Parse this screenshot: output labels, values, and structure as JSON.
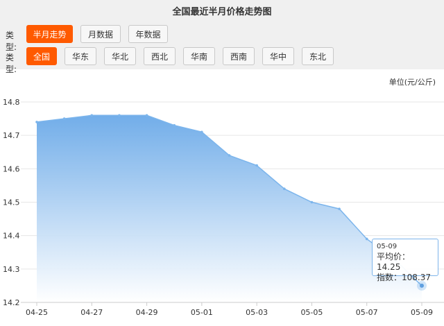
{
  "header": {
    "title": "全国最近半月价格走势图",
    "type_label_1": "类型:",
    "type_label_2": "类型:",
    "period_buttons": [
      {
        "label": "半月走势",
        "active": true
      },
      {
        "label": "月数据",
        "active": false
      },
      {
        "label": "年数据",
        "active": false
      }
    ],
    "region_buttons": [
      {
        "label": "全国",
        "active": true
      },
      {
        "label": "华东",
        "active": false
      },
      {
        "label": "华北",
        "active": false
      },
      {
        "label": "西北",
        "active": false
      },
      {
        "label": "华南",
        "active": false
      },
      {
        "label": "西南",
        "active": false
      },
      {
        "label": "华中",
        "active": false
      },
      {
        "label": "东北",
        "active": false
      }
    ]
  },
  "colors": {
    "accent": "#ff5a00",
    "line": "#7cb5ec",
    "fill_top": "#6aa9e8",
    "fill_bottom": "#ffffff"
  },
  "chart_data": {
    "type": "area",
    "unit_label": "单位(元/公斤)",
    "x": [
      "04-25",
      "04-26",
      "04-27",
      "04-28",
      "04-29",
      "04-30",
      "05-01",
      "05-02",
      "05-03",
      "05-04",
      "05-05",
      "05-06",
      "05-07",
      "05-08",
      "05-09"
    ],
    "x_tick_labels": [
      "04-25",
      "04-27",
      "04-29",
      "05-01",
      "05-03",
      "05-05",
      "05-07",
      "05-09"
    ],
    "values": [
      14.74,
      14.75,
      14.76,
      14.76,
      14.76,
      14.73,
      14.71,
      14.64,
      14.61,
      14.54,
      14.5,
      14.48,
      14.39,
      14.33,
      14.25
    ],
    "y_ticks": [
      "14.2",
      "14.3",
      "14.4",
      "14.5",
      "14.6",
      "14.7",
      "14.8"
    ],
    "ylim": [
      14.2,
      14.8
    ],
    "grid": true,
    "tooltip": {
      "date": "05-09",
      "avg_price": "平均价：14.25",
      "index": "指数：108.37"
    }
  }
}
